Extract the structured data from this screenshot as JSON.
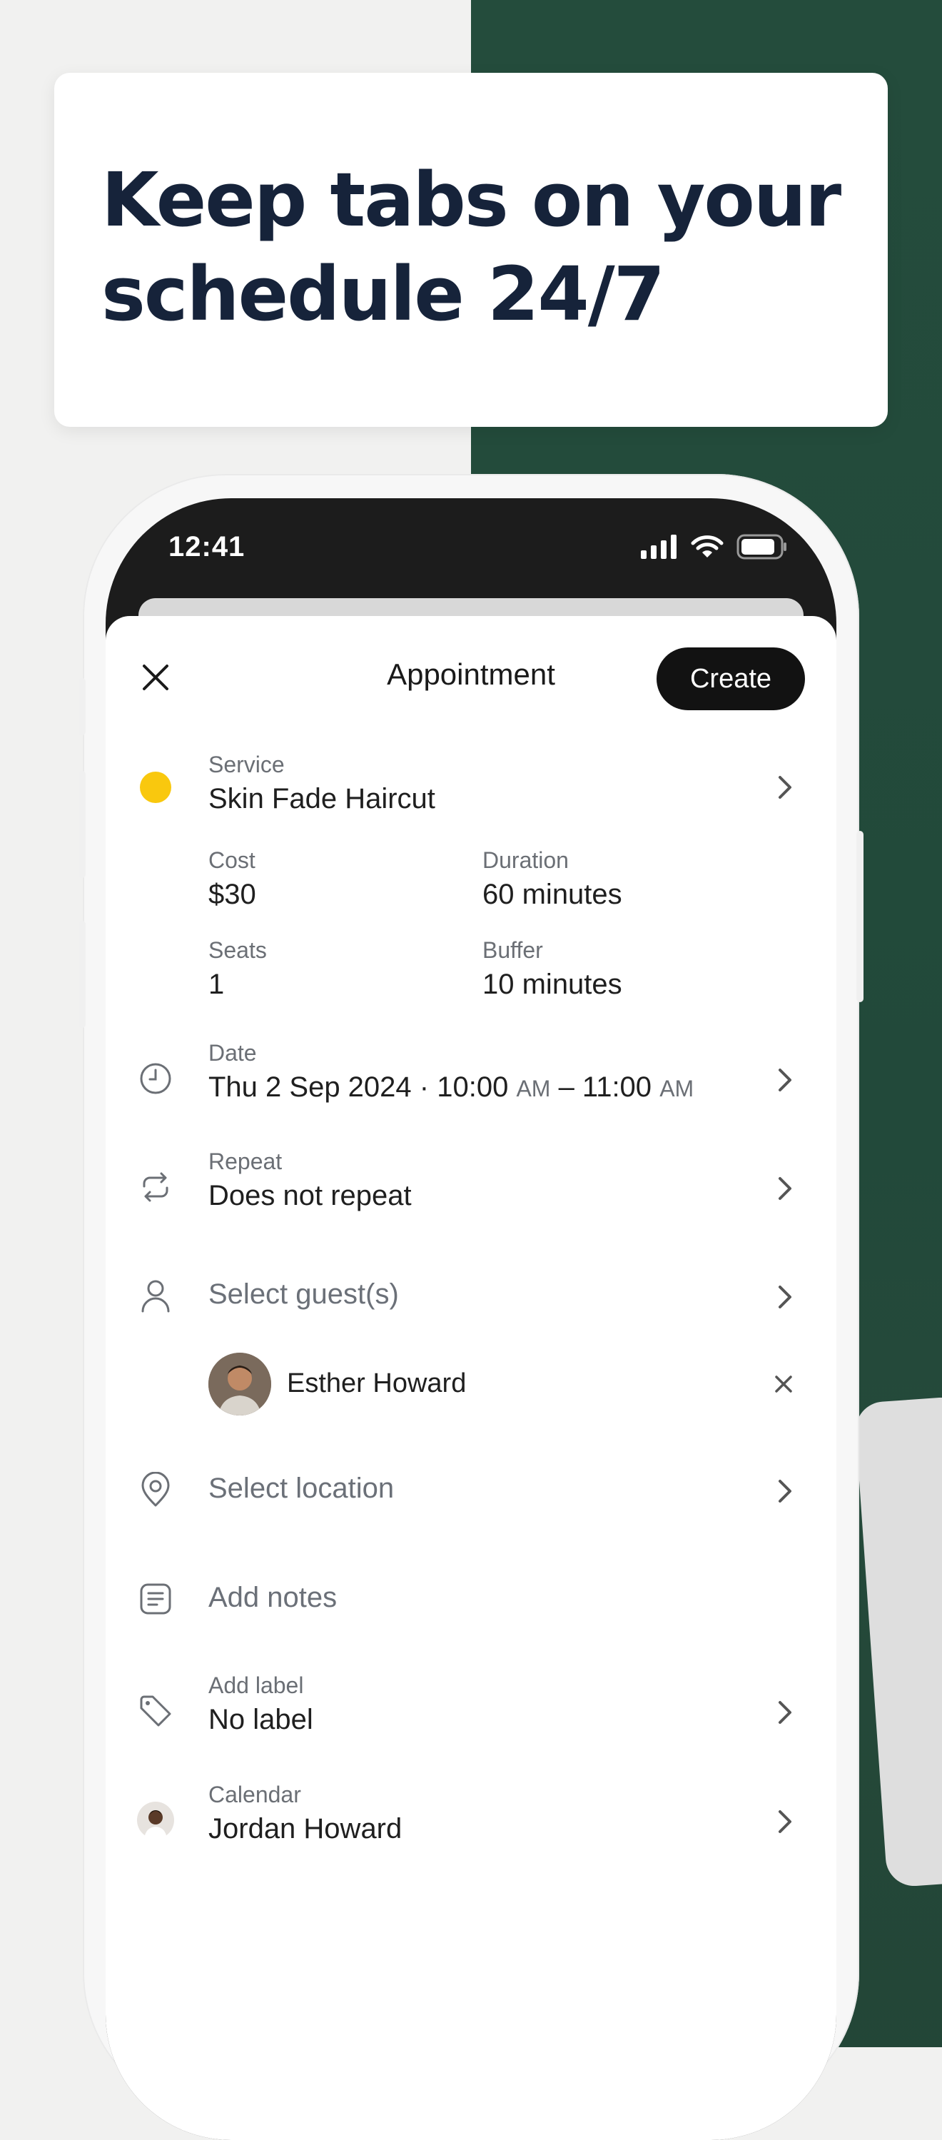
{
  "headline": "Keep tabs on your schedule 24/7",
  "status_bar": {
    "time": "12:41"
  },
  "sheet": {
    "title": "Appointment",
    "create_label": "Create"
  },
  "service": {
    "label": "Service",
    "value": "Skin Fade Haircut",
    "color": "#F9C80E",
    "cost_label": "Cost",
    "cost_value": "$30",
    "duration_label": "Duration",
    "duration_value": "60 minutes",
    "seats_label": "Seats",
    "seats_value": "1",
    "buffer_label": "Buffer",
    "buffer_value": "10 minutes"
  },
  "date": {
    "label": "Date",
    "day": "Thu 2 Sep 2024 · 10:00",
    "start_ampm": "AM",
    "end": " – 11:00",
    "end_ampm": "AM"
  },
  "repeat": {
    "label": "Repeat",
    "value": "Does not repeat"
  },
  "guests": {
    "placeholder": "Select guest(s)",
    "selected": [
      {
        "name": "Esther Howard"
      }
    ]
  },
  "location": {
    "placeholder": "Select location"
  },
  "notes": {
    "placeholder": "Add notes"
  },
  "label_row": {
    "label": "Add label",
    "value": "No label"
  },
  "calendar": {
    "label": "Calendar",
    "value": "Jordan Howard"
  },
  "colors": {
    "accent_dark": "#121212",
    "brand_green": "#244C3C",
    "headline": "#16233A"
  }
}
